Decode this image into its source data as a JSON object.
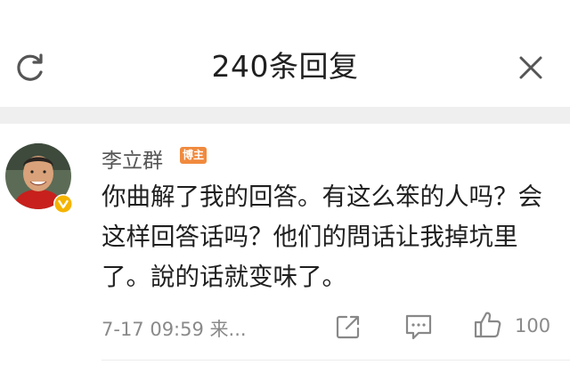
{
  "header": {
    "title": "240条回复",
    "refresh_icon": "refresh-icon",
    "close_icon": "close-icon"
  },
  "comment": {
    "author": "李立群",
    "author_badge": "博主",
    "content": "你曲解了我的回答。有这么笨的人吗？会这样回答话吗？他们的問话让我掉坑里了。說的话就变味了。",
    "time": "7-17 09:59 来...",
    "like_count": "100",
    "icons": {
      "repost": "share-icon",
      "reply": "comment-icon",
      "like": "thumbs-up-icon",
      "verified": "verified-v-icon"
    },
    "colors": {
      "badge": "#f08a3e",
      "verified": "#f5b400"
    }
  }
}
